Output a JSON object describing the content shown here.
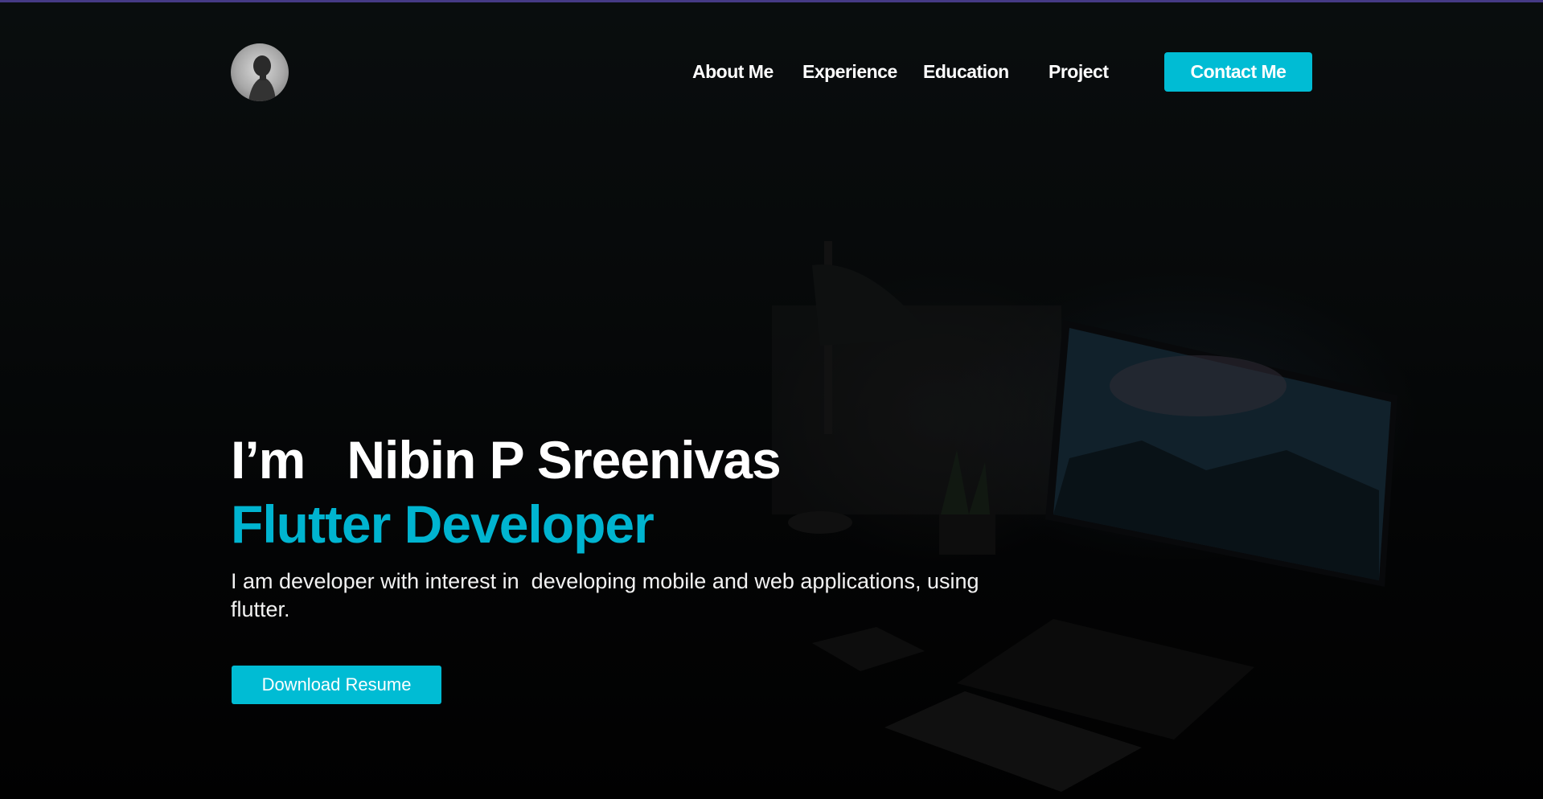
{
  "nav": {
    "links": [
      {
        "label": "About Me"
      },
      {
        "label": "Experience"
      },
      {
        "label": "Education"
      },
      {
        "label": "Project"
      }
    ],
    "contact_label": "Contact Me",
    "avatar_icon": "profile-photo"
  },
  "hero": {
    "greeting": "I’m   Nibin P Sreenivas",
    "role": "Flutter Developer",
    "description": "I am developer with interest in  developing mobile and web applications, using flutter.",
    "download_label": "Download Resume"
  },
  "colors": {
    "accent": "#00bcd4",
    "role_text": "#00b4d0",
    "background": "#050607",
    "top_strip": "#6a5acd"
  }
}
